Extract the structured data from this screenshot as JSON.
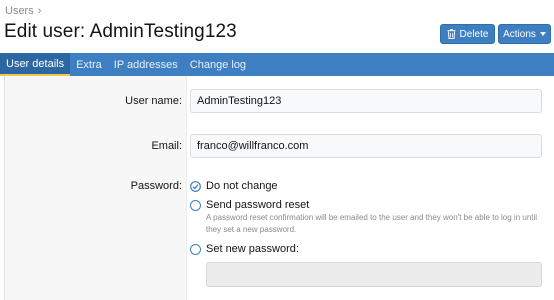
{
  "breadcrumb": {
    "item": "Users"
  },
  "page": {
    "title": "Edit user: AdminTesting123"
  },
  "header": {
    "delete_label": "Delete",
    "actions_label": "Actions"
  },
  "tabs": [
    {
      "label": "User details",
      "active": true
    },
    {
      "label": "Extra",
      "active": false
    },
    {
      "label": "IP addresses",
      "active": false
    },
    {
      "label": "Change log",
      "active": false
    }
  ],
  "form": {
    "username": {
      "label": "User name:",
      "value": "AdminTesting123"
    },
    "email": {
      "label": "Email:",
      "value": "franco@willfranco.com"
    },
    "password": {
      "label": "Password:",
      "options": [
        {
          "label": "Do not change",
          "selected": true
        },
        {
          "label": "Send password reset",
          "selected": false
        },
        {
          "label": "Set new password:",
          "selected": false
        }
      ],
      "reset_hint": "A password reset confirmation will be emailed to the user and they won't be able to log in until they set a new password.",
      "new_password_value": ""
    }
  },
  "colors": {
    "accent": "#3d7fc1",
    "tab_active": "#2c67a4",
    "tab_indicator": "#f2c94c"
  },
  "icons": {
    "delete": "trash-icon",
    "actions": "caret-down-icon",
    "breadcrumb_sep": "chevron-right-icon",
    "selected_option": "checkmark-icon"
  }
}
